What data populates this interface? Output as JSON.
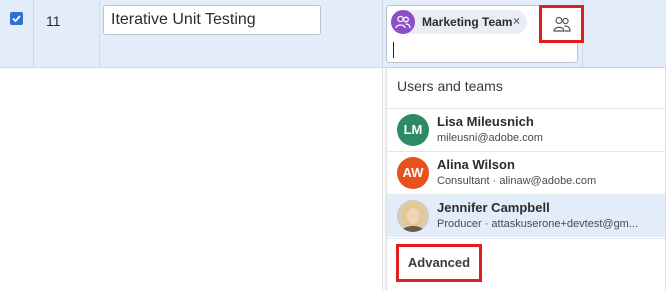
{
  "row": {
    "checked": true,
    "number": "11",
    "name_value": "Iterative Unit Testing"
  },
  "assignment": {
    "tag_label": "Marketing Team",
    "tag_remove": "×",
    "team_icon": "team-icon",
    "picker_icon": "users-icon"
  },
  "dropdown": {
    "header": "Users and teams",
    "users": [
      {
        "initials": "LM",
        "name": "Lisa Mileusnich",
        "sub": "mileusni@adobe.com",
        "color": "#2e8a62"
      },
      {
        "initials": "AW",
        "name": "Alina Wilson",
        "sub": "Consultant · alinaw@adobe.com",
        "color": "#e8501c"
      },
      {
        "initials": "",
        "name": "Jennifer Campbell",
        "sub": "Producer · attaskuserone+devtest@gm...",
        "avatar": "photo"
      }
    ],
    "advanced_label": "Advanced"
  },
  "colors": {
    "highlight": "#e01f1f",
    "row_selected": "#e3edfa",
    "team_purple": "#8b4fc6"
  }
}
